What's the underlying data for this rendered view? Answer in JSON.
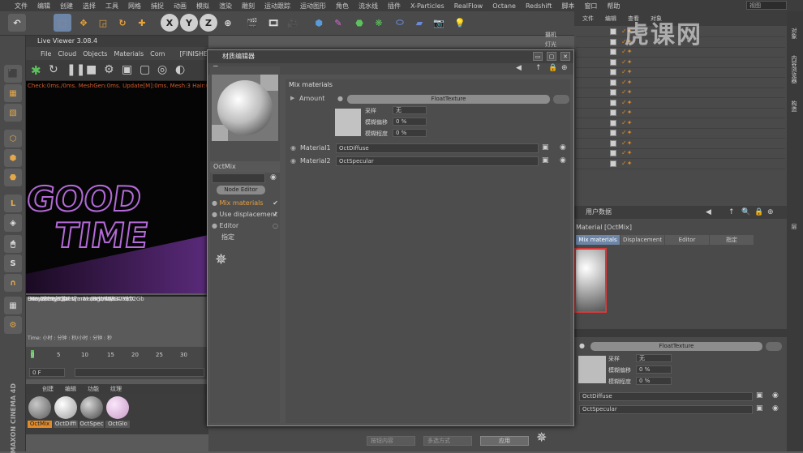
{
  "menubar": {
    "items": [
      "文件",
      "编辑",
      "创建",
      "选择",
      "工具",
      "网格",
      "捕捉",
      "动画",
      "模拟",
      "渲染",
      "雕刻",
      "运动跟踪",
      "运动图形",
      "角色",
      "流水线",
      "插件",
      "X-Particles",
      "RealFlow",
      "Octane",
      "Redshift",
      "脚本",
      "窗口",
      "帮助"
    ],
    "search_text": "视图"
  },
  "live_viewer": {
    "title": "Live Viewer 3.08.4",
    "menu": [
      "File",
      "Cloud",
      "Objects",
      "Materials",
      "Com"
    ],
    "finished": "[FINISHED]",
    "status": "Check:0ms./0ms. MeshGen:0ms. Update[M]:0ms. Mesh:3 Hair:0",
    "viewport_text_line1": "GOOD",
    "viewport_text_line2": "TIME",
    "gpu": "GTX 1050[T][6.1]",
    "gpu_pct": "%4",
    "gpu_temp": "33°C",
    "out_of_core": "Out-of-core used/max:0Kb/4Gb",
    "grey": "Grey8/16: 0/0",
    "rgb": "Rgb32/64: 0/0",
    "vram": "Used/free/total vram: 631Mb/830Mb/2Gb",
    "rendering": "Rendering: 100%",
    "mspersec": "Ms/sec: 22.17",
    "time": "Time: 小时 : 分钟 : 秒/小时 : 分钟 : 秒"
  },
  "timeline": {
    "ticks": [
      "0",
      "5",
      "10",
      "15",
      "20",
      "25",
      "30"
    ],
    "frame": "0 F"
  },
  "material_bar": {
    "tabs": [
      "创建",
      "编辑",
      "功能",
      "纹理"
    ],
    "materials": [
      {
        "name": "OctMix",
        "color": "#9a9a9a"
      },
      {
        "name": "OctDiffi",
        "color": "#dcdcdc"
      },
      {
        "name": "OctSpec",
        "color": "#8a8a8a"
      },
      {
        "name": "OctGlo",
        "color": "#e8c5e8"
      }
    ]
  },
  "dialog": {
    "title": "材质编辑器",
    "name": "OctMix",
    "node_editor": "Node Editor",
    "channels": [
      {
        "label": "Mix materials",
        "active": true
      },
      {
        "label": "Use displacement",
        "active": false
      },
      {
        "label": "Editor",
        "active": false
      },
      {
        "label": "指定",
        "active": false
      }
    ],
    "section": "Mix materials",
    "amount_label": "Amount",
    "amount_value": "FloatTexture",
    "sub_fields": [
      {
        "label": "采样",
        "value": "无"
      },
      {
        "label": "模糊偏移",
        "value": "0 %"
      },
      {
        "label": "模糊程度",
        "value": "0 %"
      }
    ],
    "material1_label": "Material1",
    "material1_value": "OctDiffuse",
    "material2_label": "Material2",
    "material2_value": "OctSpecular"
  },
  "right_panel": {
    "tabs": [
      "文件",
      "编辑",
      "查看",
      "对象"
    ],
    "objects": [
      "摄机",
      "灯光"
    ],
    "attr_title": "用户数据",
    "attr_material": "Material [OctMix]",
    "attr_tabs": [
      "Mix materials",
      "Displacement",
      "Editor",
      "指定"
    ],
    "attr_float": "FloatTexture",
    "attr_fields": [
      {
        "label": "采样",
        "value": "无"
      },
      {
        "label": "模糊偏移",
        "value": "0 %"
      },
      {
        "label": "模糊程度",
        "value": "0 %"
      }
    ],
    "attr_mat1": "OctDiffuse",
    "attr_mat2": "OctSpecular",
    "side_tabs": [
      "对象",
      "内容浏览器",
      "构造",
      "层"
    ]
  },
  "watermark": "虎课网",
  "bottom": {
    "apply": "应用",
    "left_dd": "按钮内容",
    "right_dd": "多选方式"
  },
  "logo_text": "MAXON CINEMA 4D"
}
